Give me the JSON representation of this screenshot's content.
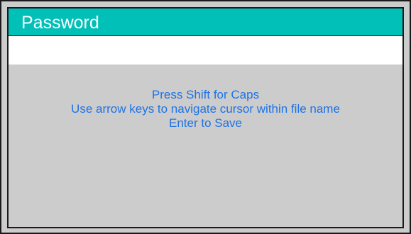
{
  "dialog": {
    "title": "Password",
    "password_value": "",
    "instructions": [
      "Press Shift for Caps",
      "Use arrow keys to navigate cursor within file name",
      "Enter to Save"
    ]
  },
  "colors": {
    "title_bar": "#00c0b8",
    "title_text": "#ffffff",
    "body_background": "#cccccc",
    "instruction_text": "#1e73e6",
    "border": "#1a1a1a"
  }
}
